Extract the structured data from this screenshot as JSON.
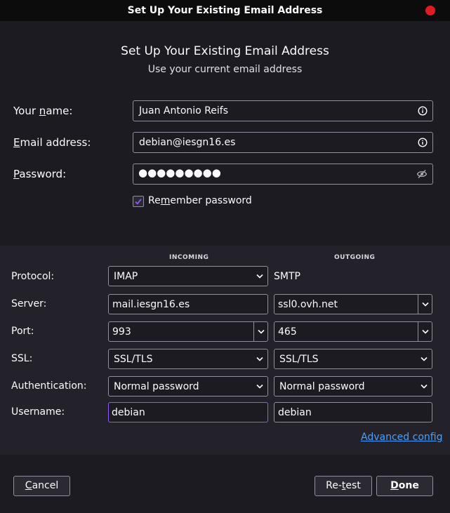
{
  "window": {
    "title": "Set Up Your Existing Email Address"
  },
  "header": {
    "heading": "Set Up Your Existing Email Address",
    "subheading": "Use your current email address"
  },
  "account": {
    "name_label_pre": "Your ",
    "name_label_key": "n",
    "name_label_post": "ame:",
    "name_value": "Juan Antonio Reifs",
    "email_label_key": "E",
    "email_label_post": "mail address:",
    "email_value": "debian@iesgn16.es",
    "password_label_key": "P",
    "password_label_post": "assword:",
    "password_mask": "●●●●●●●●●",
    "remember_pre": "Re",
    "remember_key": "m",
    "remember_post": "ember password",
    "remember_checked": true
  },
  "server_config": {
    "incoming_header": "INCOMING",
    "outgoing_header": "OUTGOING",
    "rows": {
      "protocol": {
        "label": "Protocol:",
        "incoming": "IMAP",
        "outgoing": "SMTP"
      },
      "server": {
        "label": "Server:",
        "incoming": "mail.iesgn16.es",
        "outgoing": "ssl0.ovh.net"
      },
      "port": {
        "label": "Port:",
        "incoming": "993",
        "outgoing": "465"
      },
      "ssl": {
        "label": "SSL:",
        "incoming": "SSL/TLS",
        "outgoing": "SSL/TLS"
      },
      "auth": {
        "label": "Authentication:",
        "incoming": "Normal password",
        "outgoing": "Normal password"
      },
      "username": {
        "label": "Username:",
        "incoming": "debian",
        "outgoing": "debian"
      }
    },
    "advanced_key": "A",
    "advanced_post": "dvanced config"
  },
  "buttons": {
    "cancel_key": "C",
    "cancel_post": "ancel",
    "retest_pre": "Re-",
    "retest_key": "t",
    "retest_post": "est",
    "done_key": "D",
    "done_post": "one"
  },
  "colors": {
    "accent": "#9059ff",
    "link": "#45a1ff",
    "close": "#e01b24"
  }
}
